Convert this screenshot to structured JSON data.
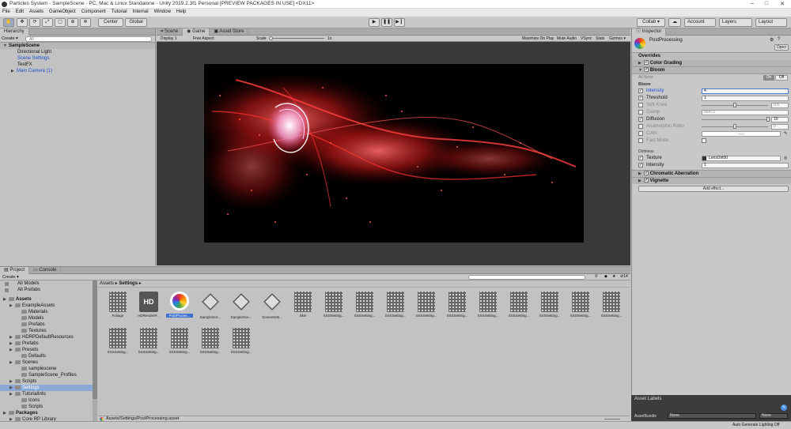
{
  "window": {
    "title": "Particles System - SampleScene - PC, Mac & Linux Standalone - Unity 2019.2.3f1 Personal [PREVIEW PACKAGES IN USE] <DX11>",
    "min": "–",
    "max": "□",
    "close": "✕"
  },
  "menu": [
    "File",
    "Edit",
    "Assets",
    "GameObject",
    "Component",
    "Tutorial",
    "Internal",
    "Window",
    "Help"
  ],
  "toolbar": {
    "pivot": "Center",
    "space": "Global",
    "collab": "Collab ▾",
    "account": "Account",
    "layers": "Layers",
    "layout": "Layout"
  },
  "hierarchy": {
    "tab": "Hierarchy",
    "create": "Create ▾",
    "search_placeholder": "All",
    "scene": "SampleScene",
    "items": [
      "Directional Light",
      "Scene Settings",
      "TestFX",
      "Main Camera (1)"
    ]
  },
  "scene_tabs": {
    "scene": "Scene",
    "game": "Game",
    "asset_store": "Asset Store"
  },
  "game_bar": {
    "display": "Display 1",
    "aspect": "Free Aspect",
    "scale_label": "Scale",
    "scale_value": "1x",
    "maximize": "Maximize On Play",
    "mute": "Mute Audio",
    "vsync": "VSync",
    "stats": "Stats",
    "gizmos": "Gizmos ▾"
  },
  "inspector": {
    "tab": "Inspector",
    "name": "PostProcessing",
    "open": "Open",
    "overrides": "Overrides",
    "sections": {
      "color_grading": "Color Grading",
      "bloom": "Bloom",
      "chromatic": "Chromatic Aberration",
      "vignette": "Vignette"
    },
    "all_none": "All  None",
    "on": "On",
    "off": "Off",
    "bloom_header": "Bloom",
    "fields": [
      {
        "label": "Intensity",
        "value": "4",
        "active": true,
        "blue": true
      },
      {
        "label": "Threshold",
        "value": "1",
        "active": true
      },
      {
        "label": "Soft Knee",
        "value": "0.5",
        "active": false,
        "slider": 0.5
      },
      {
        "label": "Clamp",
        "value": "65472",
        "active": false
      },
      {
        "label": "Diffusion",
        "value": "10",
        "active": true,
        "slider": 1.0
      },
      {
        "label": "Anamorphic Ratio",
        "value": "0",
        "active": false,
        "slider": 0.5
      },
      {
        "label": "Color",
        "value": "HDR",
        "active": false
      },
      {
        "label": "Fast Mode",
        "value": "",
        "active": false
      }
    ],
    "dirtiness": "Dirtiness",
    "texture": {
      "label": "Texture",
      "value": "LensDirt00"
    },
    "dirt_intensity": {
      "label": "Intensity",
      "value": "1"
    },
    "add_effect": "Add effect...",
    "asset_labels": "Asset Labels",
    "asset_bundle": {
      "label": "AssetBundle",
      "value1": "None",
      "value2": "None"
    }
  },
  "project": {
    "tab_project": "Project",
    "tab_console": "Console",
    "create": "Create ▾",
    "favorites": [
      "All Models",
      "All Prefabs"
    ],
    "tree": [
      {
        "label": "Assets",
        "level": 0,
        "bold": true
      },
      {
        "label": "ExampleAssets",
        "level": 1
      },
      {
        "label": "Materials",
        "level": 2
      },
      {
        "label": "Models",
        "level": 2
      },
      {
        "label": "Prefabs",
        "level": 2
      },
      {
        "label": "Textures",
        "level": 2
      },
      {
        "label": "HDRPDefaultResources",
        "level": 1
      },
      {
        "label": "Prefabs",
        "level": 1
      },
      {
        "label": "Presets",
        "level": 1
      },
      {
        "label": "Defaults",
        "level": 2
      },
      {
        "label": "Scenes",
        "level": 1
      },
      {
        "label": "samplescene",
        "level": 2
      },
      {
        "label": "SampleScene_Profiles",
        "level": 2
      },
      {
        "label": "Scripts",
        "level": 1
      },
      {
        "label": "Settings",
        "level": 1,
        "selected": true
      },
      {
        "label": "TutorialInfo",
        "level": 1
      },
      {
        "label": "Icons",
        "level": 2
      },
      {
        "label": "Scripts",
        "level": 2
      },
      {
        "label": "Packages",
        "level": 0,
        "bold": true
      },
      {
        "label": "Core RP Library",
        "level": 1
      }
    ],
    "breadcrumb": [
      "Assets",
      "Settings"
    ],
    "count_badge": "14",
    "assets_row1": [
      "Foliage",
      "HDRenderP...",
      "PostProces...",
      "SampleSce...",
      "SampleSce...",
      "SceneSetti...",
      "Skin",
      "SSSSetting...",
      "SSSSetting...",
      "SSSSetting...",
      "SSSSetting...",
      "SSSSetting...",
      "SSSSetting...",
      "SSSSetting...",
      "SSSSetting...",
      "SSSSetting...",
      "SSSSetting..."
    ],
    "assets_row2": [
      "SSSSetting...",
      "SSSSetting...",
      "SSSSetting...",
      "SSSSetting...",
      "SSSSetting..."
    ],
    "status_path": "Assets/Settings/PostProcessing.asset"
  },
  "status": {
    "lighting": "Auto Generate Lighting Off"
  }
}
